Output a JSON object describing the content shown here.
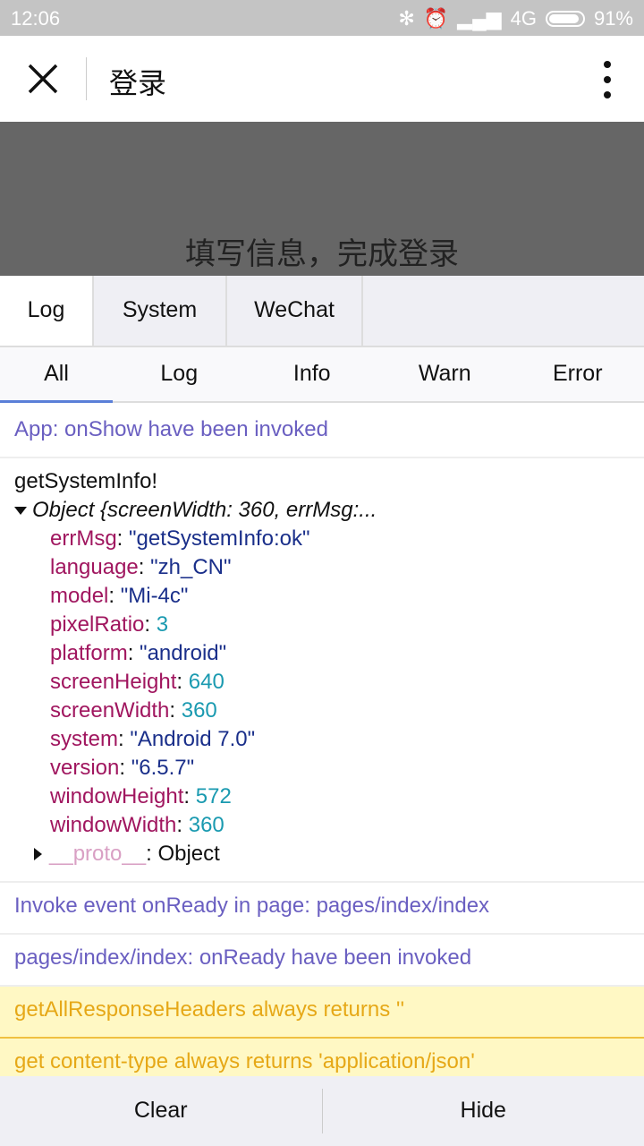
{
  "status_bar": {
    "time": "12:06",
    "network": "4G",
    "battery": "91%"
  },
  "nav": {
    "title": "登录"
  },
  "hero": {
    "text": "填写信息，完成登录"
  },
  "tabs": [
    {
      "label": "Log"
    },
    {
      "label": "System"
    },
    {
      "label": "WeChat"
    }
  ],
  "filters": [
    {
      "label": "All"
    },
    {
      "label": "Log"
    },
    {
      "label": "Info"
    },
    {
      "label": "Warn"
    },
    {
      "label": "Error"
    }
  ],
  "logs": {
    "onshow": "App: onShow have been invoked",
    "sysinfo": {
      "header": "getSystemInfo!",
      "summary": "Object {screenWidth: 360, errMsg:...",
      "props": [
        {
          "key": "errMsg",
          "value": "\"getSystemInfo:ok\""
        },
        {
          "key": "language",
          "value": "\"zh_CN\""
        },
        {
          "key": "model",
          "value": "\"Mi-4c\""
        },
        {
          "key": "pixelRatio",
          "value": "3"
        },
        {
          "key": "platform",
          "value": "\"android\""
        },
        {
          "key": "screenHeight",
          "value": "640"
        },
        {
          "key": "screenWidth",
          "value": "360"
        },
        {
          "key": "system",
          "value": "\"Android 7.0\""
        },
        {
          "key": "version",
          "value": "\"6.5.7\""
        },
        {
          "key": "windowHeight",
          "value": "572"
        },
        {
          "key": "windowWidth",
          "value": "360"
        }
      ],
      "proto_key": "__proto__",
      "proto_value": "Object"
    },
    "invoke_ready": "Invoke event onReady in page: pages/index/index",
    "page_ready": "pages/index/index: onReady have been invoked",
    "warn1": "getAllResponseHeaders always returns ''",
    "warn2": "get content-type always returns 'application/json'"
  },
  "bottom": {
    "clear": "Clear",
    "hide": "Hide"
  }
}
